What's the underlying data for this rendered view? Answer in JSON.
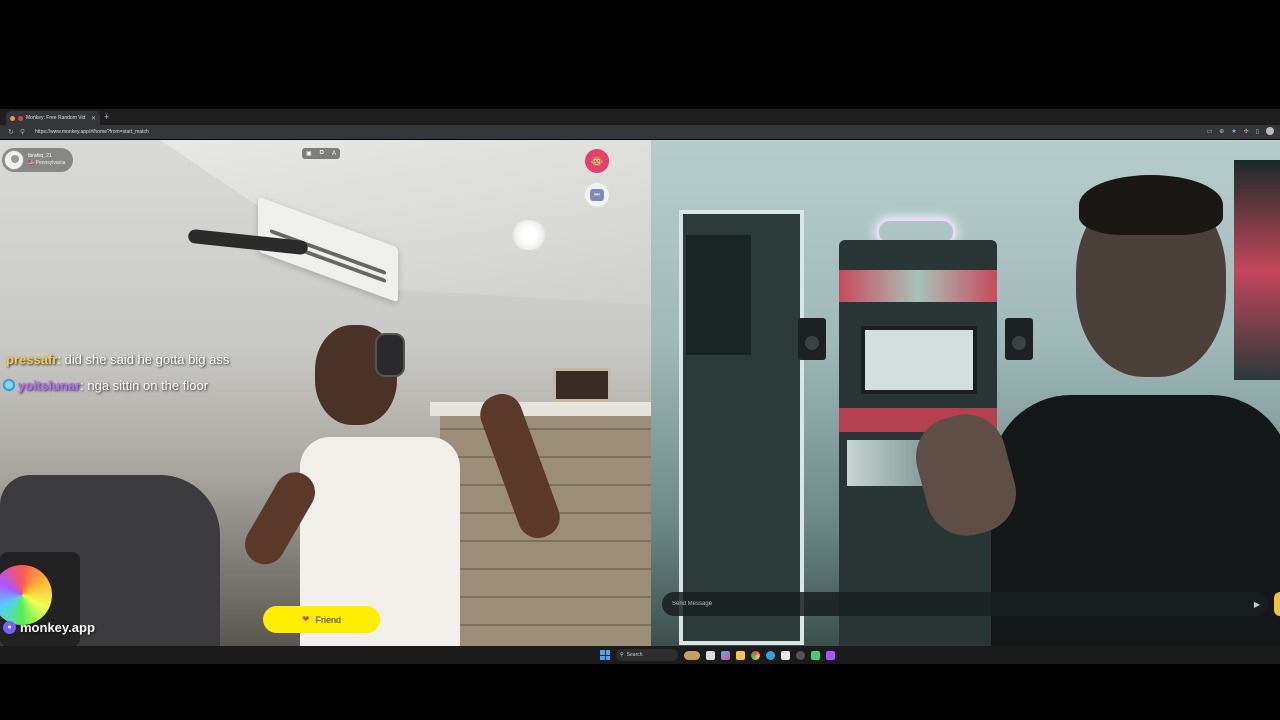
{
  "browser": {
    "tab_title": "Monkey: Free Random Vid",
    "new_tab": "+",
    "url": "https://www.monkey.app/#/home?from=start_match"
  },
  "match": {
    "username": "Ibrahiq, 21",
    "location": "🇺🇸 Pennsylvania"
  },
  "chat": [
    {
      "user": "pressafr",
      "sep": ": ",
      "text": "did she said he gotta big ass",
      "color": "#f2c94c"
    },
    {
      "user": "yoitslunar",
      "sep": ": ",
      "text": "nga sittin on the floor",
      "color": "#b36bff"
    }
  ],
  "controls": {
    "friend_label": "Friend",
    "send_placeholder": "Send Message"
  },
  "watermark": "monkey.app",
  "taskbar": {
    "search_label": "Search"
  },
  "colors": {
    "friend_button": "#ffee00",
    "badge": "#e83e6f"
  }
}
